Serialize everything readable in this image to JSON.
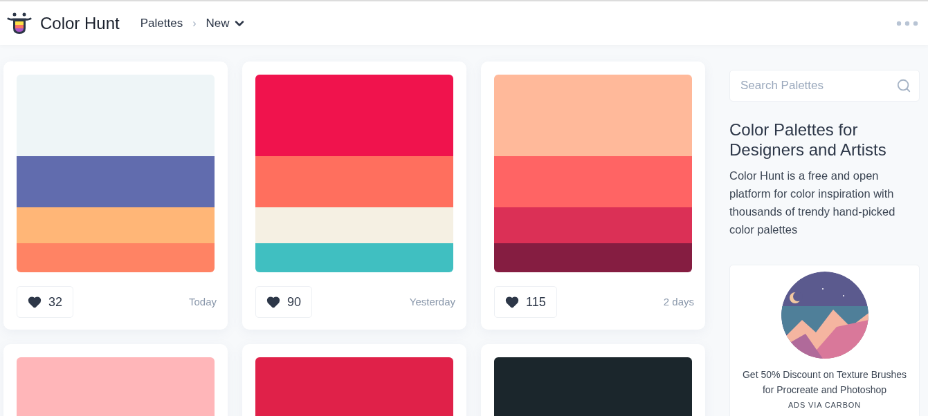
{
  "header": {
    "brand": "Color Hunt",
    "breadcrumb": [
      "Palettes",
      "New"
    ],
    "separator": "›"
  },
  "palettes": [
    {
      "swatches": [
        {
          "color": "#eef5f7"
        },
        {
          "color": "#616cae"
        },
        {
          "color": "#ffb677"
        },
        {
          "color": "#ff8364"
        }
      ],
      "likes": "32",
      "date": "Today"
    },
    {
      "swatches": [
        {
          "color": "#f0134d"
        },
        {
          "color": "#ff6f5e"
        },
        {
          "color": "#f5f0e3"
        },
        {
          "color": "#40bfc1"
        }
      ],
      "likes": "90",
      "date": "Yesterday"
    },
    {
      "swatches": [
        {
          "color": "#ffb99a"
        },
        {
          "color": "#ff6464"
        },
        {
          "color": "#db3056"
        },
        {
          "color": "#851d41"
        }
      ],
      "likes": "115",
      "date": "2 days"
    },
    {
      "swatches": [
        {
          "color": "#ffb6b9"
        }
      ]
    },
    {
      "swatches": [
        {
          "color": "#e02149"
        }
      ]
    },
    {
      "swatches": [
        {
          "color": "#1b262c"
        }
      ]
    }
  ],
  "sidebar": {
    "search": {
      "placeholder": "Search Palettes"
    },
    "title": "Color Palettes for Designers and Artists",
    "description": "Color Hunt is a free and open platform for color inspiration with thousands of trendy hand-picked color palettes",
    "ad": {
      "text": "Get 50% Discount on Texture Brushes for Procreate and Photoshop",
      "via": "ADS VIA CARBON"
    }
  }
}
